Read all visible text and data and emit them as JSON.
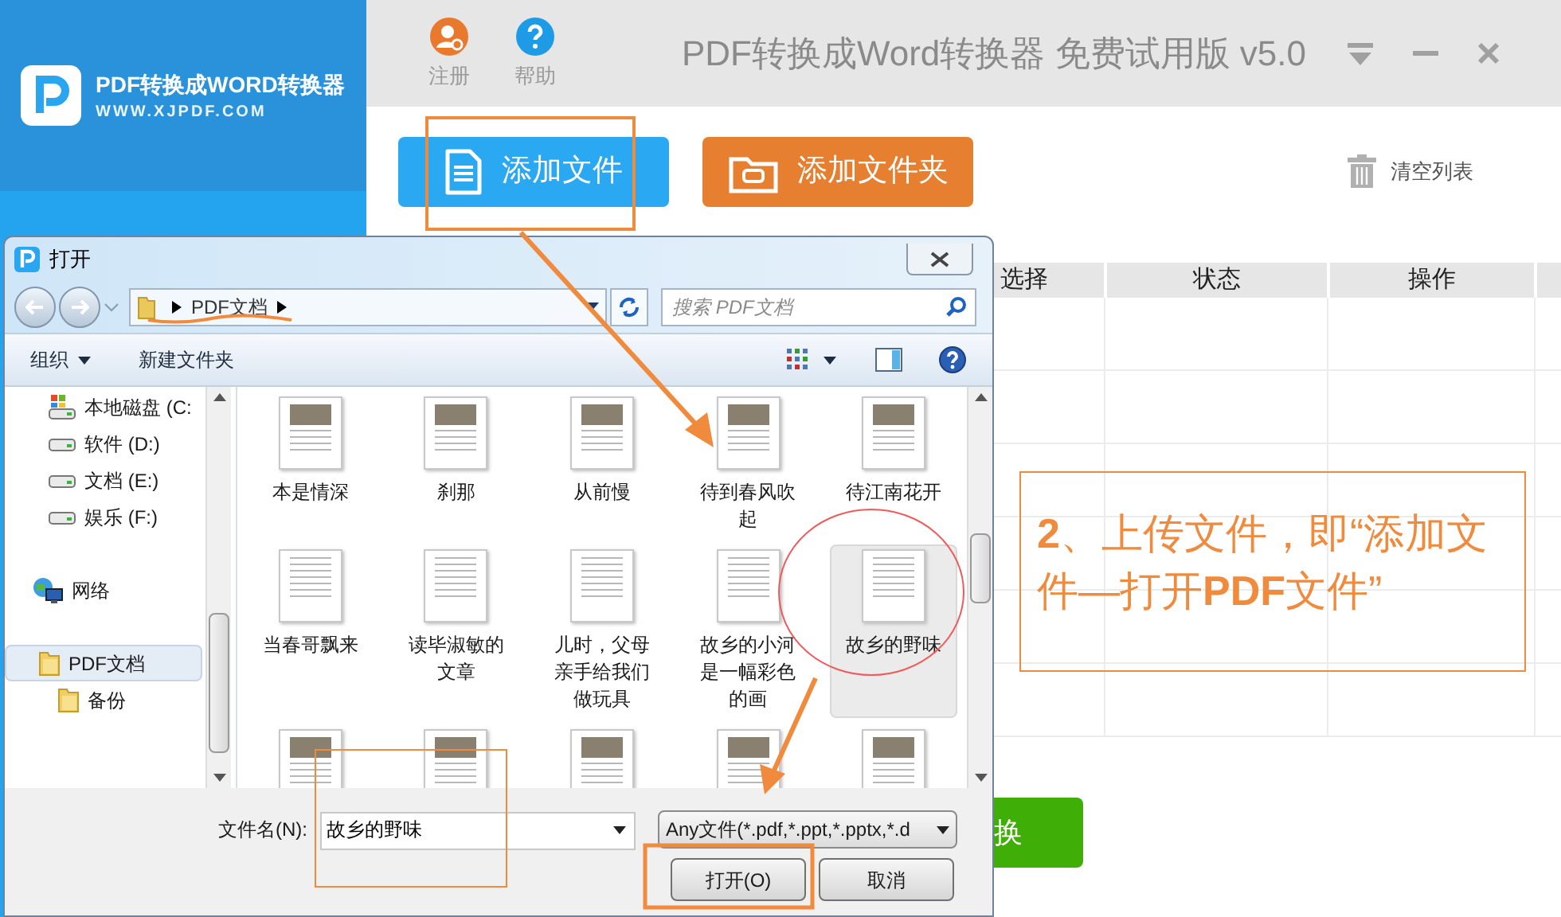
{
  "app": {
    "logo": {
      "name": "PDF转换成WORD转换器",
      "url": "WWW.XJPDF.COM"
    },
    "top_actions": [
      {
        "kind": "register",
        "label": "注册"
      },
      {
        "kind": "help",
        "label": "帮助"
      }
    ],
    "title": "PDF转换成Word转换器 免费试用版 v5.0",
    "buttons": [
      {
        "kind": "file",
        "label": "添加文件"
      },
      {
        "kind": "folder",
        "label": "添加文件夹"
      }
    ],
    "clear_list": "清空列表",
    "table": {
      "columns": [
        "选择",
        "状态",
        "操作"
      ]
    },
    "convert_button": "换"
  },
  "dialog": {
    "title": "打开",
    "breadcrumb": "PDF文档",
    "search": {
      "placeholder": "搜索 PDF文档"
    },
    "toolbar": [
      {
        "label": "组织",
        "kind": "menu"
      },
      {
        "label": "新建文件夹",
        "kind": "plain"
      }
    ],
    "nav": [
      {
        "label": "本地磁盘 (C:",
        "kind": "system_drive",
        "selected": false
      },
      {
        "label": "软件 (D:)",
        "kind": "drive",
        "selected": false
      },
      {
        "label": "文档 (E:)",
        "kind": "drive",
        "selected": false
      },
      {
        "label": "娱乐 (F:)",
        "kind": "drive",
        "selected": false
      },
      {
        "label": "网络",
        "kind": "network",
        "selected": false
      },
      {
        "label": "PDF文档",
        "kind": "folder",
        "selected": true,
        "children": [
          {
            "label": "备份",
            "kind": "folder",
            "selected": false
          }
        ]
      }
    ],
    "files": [
      {
        "label": "本是情深",
        "kind": "photo",
        "selected": false
      },
      {
        "label": "刹那",
        "kind": "photo",
        "selected": false
      },
      {
        "label": "从前慢",
        "kind": "photo",
        "selected": false
      },
      {
        "label": "待到春风吹起",
        "kind": "photo",
        "selected": false
      },
      {
        "label": "待江南花开",
        "kind": "photo",
        "selected": false
      },
      {
        "label": "当春哥飘来",
        "kind": "text",
        "selected": false
      },
      {
        "label": "读毕淑敏的文章",
        "kind": "text",
        "selected": false
      },
      {
        "label": "儿时，父母亲手给我们做玩具",
        "kind": "text",
        "selected": false
      },
      {
        "label": "故乡的小河是一幅彩色的画",
        "kind": "text",
        "selected": false
      },
      {
        "label": "故乡的野味",
        "kind": "text",
        "selected": true
      }
    ],
    "file_name": {
      "label": "文件名(N):",
      "value": "故乡的野味"
    },
    "file_type": "Any文件(*.pdf,*.ppt,*.pptx,*.d",
    "buttons": [
      "打开(O)",
      "取消"
    ]
  },
  "annotation": {
    "text": "**2**、上传文件，即“添加文件—打开**PDF**文件”"
  }
}
